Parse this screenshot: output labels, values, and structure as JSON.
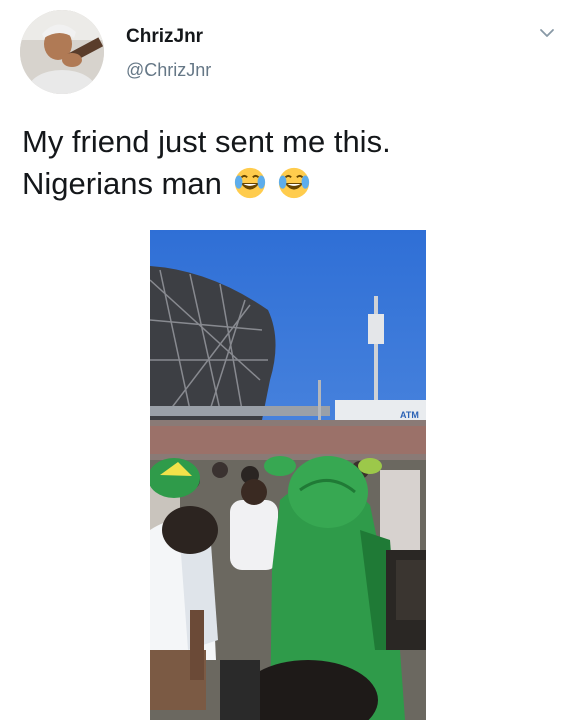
{
  "tweet": {
    "author": {
      "display_name": "ChrizJnr",
      "handle": "@ChrizJnr",
      "avatar_icon": "profile-photo"
    },
    "text_lines": [
      "My friend just sent me this.",
      "Nigerians man"
    ],
    "emojis": [
      "face-with-tears-of-joy",
      "face-with-tears-of-joy"
    ],
    "menu_icon": "chevron-down-icon",
    "media": {
      "type": "video",
      "store_sign_text": "ATM"
    }
  },
  "colors": {
    "text": "#14171a",
    "secondary": "#657786",
    "sky": "#3f78d8",
    "jersey_green": "#2f9b4a"
  }
}
